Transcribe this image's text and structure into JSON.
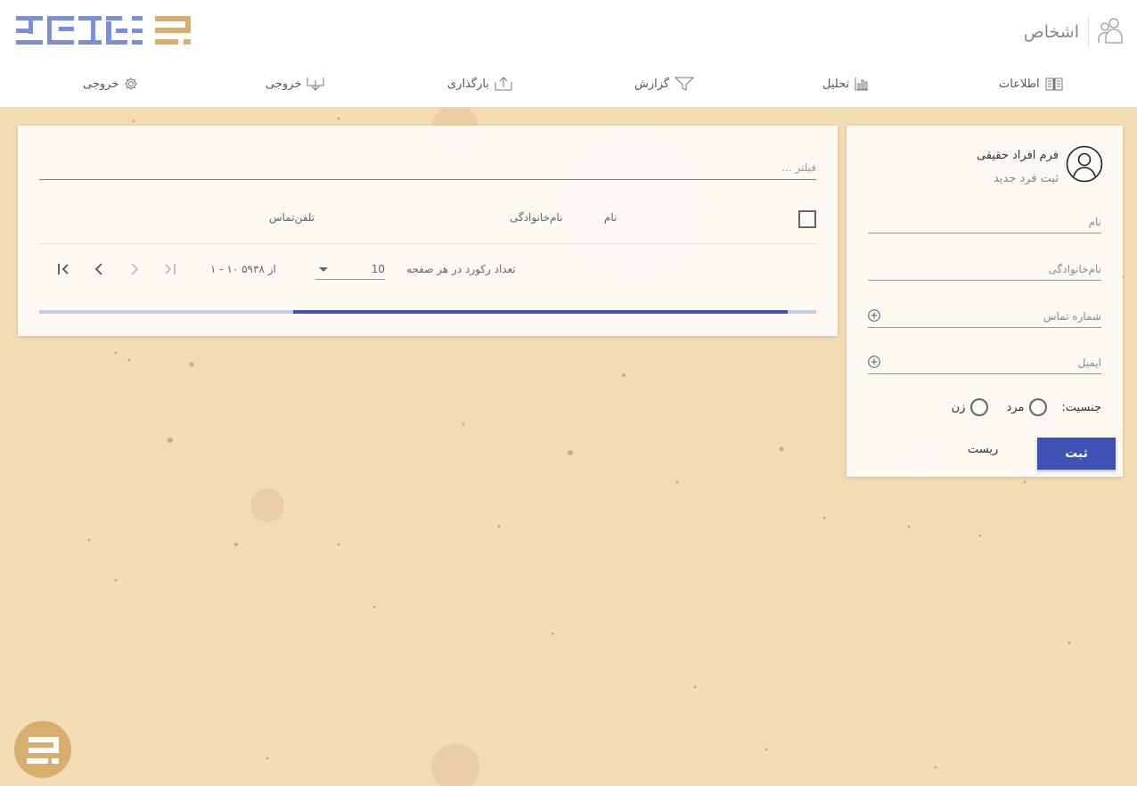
{
  "header": {
    "title": "اشخاص",
    "nav": [
      {
        "label": "اطلاعات",
        "icon": "book-icon"
      },
      {
        "label": "تحلیل",
        "icon": "chart-icon"
      },
      {
        "label": "گزارش",
        "icon": "filter-icon"
      },
      {
        "label": "بارگذاری",
        "icon": "upload-icon"
      },
      {
        "label": "خروجی",
        "icon": "download-icon"
      },
      {
        "label": "خروجی",
        "icon": "gear-icon"
      }
    ]
  },
  "form": {
    "title": "فرم افراد حقیقی",
    "subtitle": "ثبت فرد جدید",
    "fields": {
      "first_name": "نام",
      "last_name": "نام‌خانوادگی",
      "phone": "شماره تماس",
      "email": "ایمیل"
    },
    "gender": {
      "label": "جنسیت:",
      "male": "مرد",
      "female": "زن"
    },
    "submit_label": "ثبت",
    "reset_label": "ریست"
  },
  "list": {
    "filter_placeholder": "فیلتر ...",
    "columns": [
      "نام",
      "نام‌خانوادگی",
      "تلفن‌تماس"
    ],
    "rows": [],
    "paginator": {
      "items_per_page_label": "تعداد رکورد در هر صفحه",
      "page_size": "10",
      "range_label": "۱ - ۱۰ از ۵۹۳۸"
    }
  },
  "colors": {
    "accent": "#3f51b5",
    "background": "#f2dcb4",
    "logo_blue": "#7a8fd6",
    "logo_gold": "#d7ae6d"
  }
}
